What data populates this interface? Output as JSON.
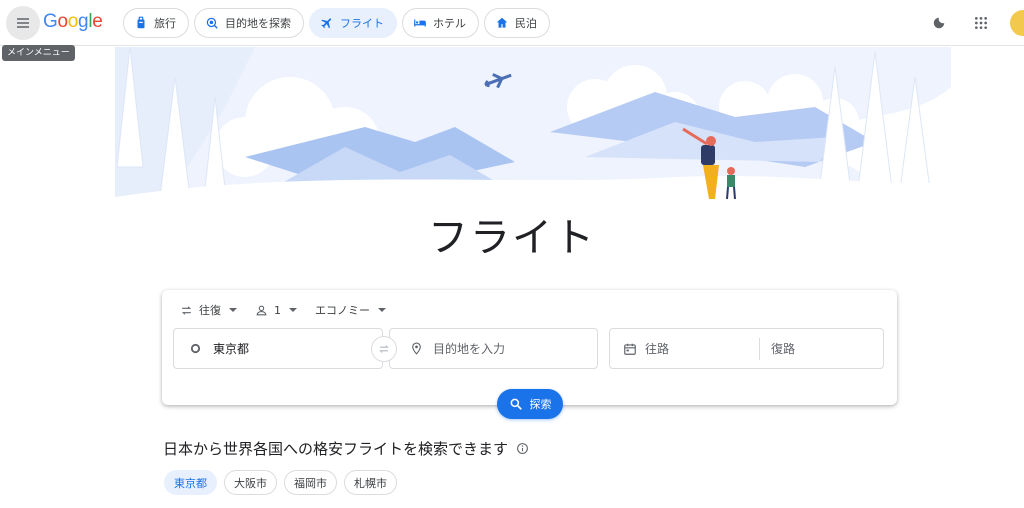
{
  "header": {
    "menu_tooltip": "メインメニュー",
    "logo": [
      "G",
      "o",
      "o",
      "g",
      "l",
      "e"
    ],
    "logo_colors": [
      "#4285F4",
      "#EA4335",
      "#FBBC05",
      "#4285F4",
      "#34A853",
      "#EA4335"
    ],
    "tabs": [
      {
        "label": "旅行",
        "icon": "travel-bag-icon",
        "active": false
      },
      {
        "label": "目的地を探索",
        "icon": "explore-icon",
        "active": false
      },
      {
        "label": "フライト",
        "icon": "airplane-icon",
        "active": true
      },
      {
        "label": "ホテル",
        "icon": "hotel-bed-icon",
        "active": false
      },
      {
        "label": "民泊",
        "icon": "house-icon",
        "active": false
      }
    ]
  },
  "hero": {
    "title": "フライト"
  },
  "search": {
    "trip_type": "往復",
    "passengers": "1",
    "cabin_class": "エコノミー",
    "origin": "東京都",
    "destination_placeholder": "目的地を入力",
    "depart_placeholder": "往路",
    "return_placeholder": "復路",
    "search_label": "探索"
  },
  "cheap": {
    "heading": "日本から世界各国への格安フライトを検索できます",
    "chips": [
      "東京都",
      "大阪市",
      "福岡市",
      "札幌市"
    ],
    "active_chip": 0
  },
  "colors": {
    "accent": "#1a73e8",
    "active_bg": "#e8f0fe"
  }
}
